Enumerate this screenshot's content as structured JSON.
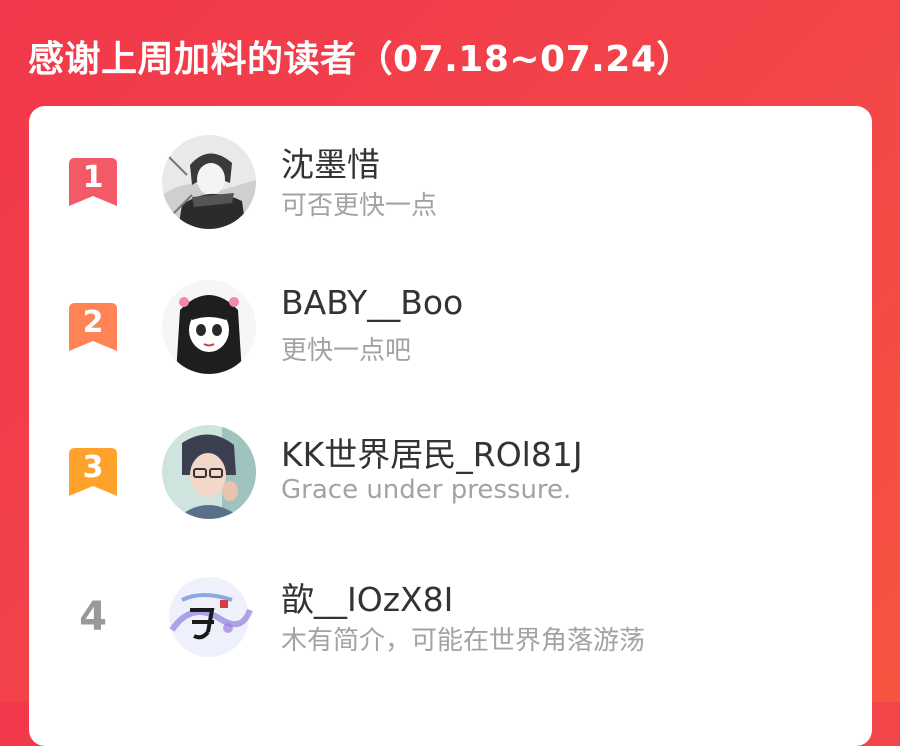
{
  "header": {
    "title": "感谢上周加料的读者（07.18~07.24）"
  },
  "leaderboard": {
    "items": [
      {
        "rank": "1",
        "name": "沈墨惜",
        "description": "可否更快一点",
        "badge_color": "#f35a67",
        "avatar_icon": "manga-boy-avatar"
      },
      {
        "rank": "2",
        "name": "BABY__Boo",
        "description": "更快一点吧",
        "badge_color": "#ff8355",
        "avatar_icon": "manga-girl-avatar"
      },
      {
        "rank": "3",
        "name": "KK世界居民_ROl81J",
        "description": "Grace under pressure.",
        "badge_color": "#ffa22b",
        "avatar_icon": "anime-glasses-avatar"
      },
      {
        "rank": "4",
        "name": "歆__IOzX8I",
        "description": "木有简介，可能在世界角落游荡",
        "avatar_icon": "calligraphy-avatar"
      }
    ]
  },
  "colors": {
    "background": "#f3454a",
    "name_text": "#333333",
    "desc_text": "#a3a3a3",
    "plain_rank": "#999999"
  }
}
